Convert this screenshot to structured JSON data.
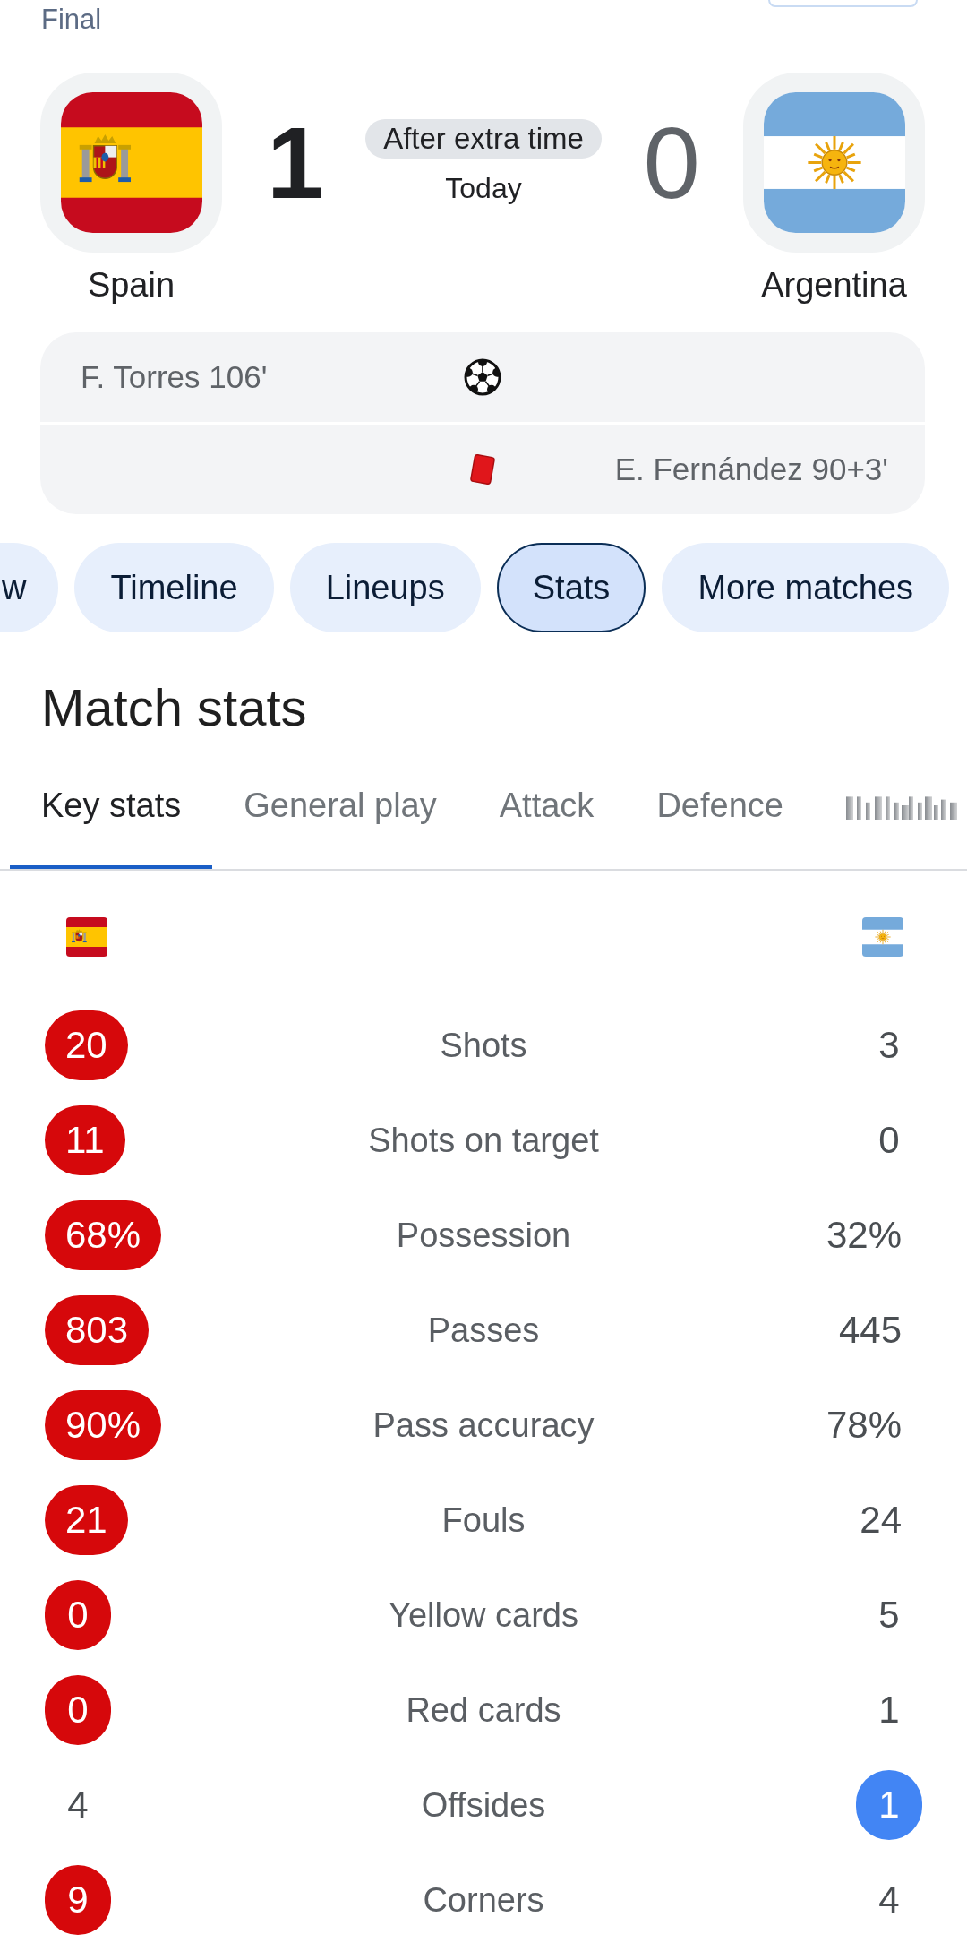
{
  "header": {
    "stage": "Final"
  },
  "teams": [
    {
      "name": "Spain",
      "score": "1",
      "winner": true,
      "kind": "spain"
    },
    {
      "name": "Argentina",
      "score": "0",
      "winner": false,
      "kind": "argentina"
    }
  ],
  "match": {
    "status": "After extra time",
    "date": "Today"
  },
  "events": [
    {
      "away_team": false,
      "kind": "goal",
      "text": "F. Torres 106'"
    },
    {
      "away_team": true,
      "kind": "red_card",
      "text": "E. Fernández 90+3'"
    }
  ],
  "chips": [
    {
      "label": "w",
      "kind": "partial",
      "selected": false
    },
    {
      "label": "Timeline",
      "kind": "full",
      "selected": false
    },
    {
      "label": "Lineups",
      "kind": "full",
      "selected": false
    },
    {
      "label": "Stats",
      "kind": "full",
      "selected": true
    },
    {
      "label": "More matches",
      "kind": "full",
      "selected": false
    }
  ],
  "section_title": "Match stats",
  "tabs": [
    {
      "label": "Key stats",
      "selected": true
    },
    {
      "label": "General play",
      "selected": false
    },
    {
      "label": "Attack",
      "selected": false
    },
    {
      "label": "Defence",
      "selected": false
    }
  ],
  "stats": [
    {
      "label": "Shots",
      "home": {
        "value": "20",
        "highlighted": true
      },
      "away": {
        "value": "3",
        "highlighted": false
      }
    },
    {
      "label": "Shots on target",
      "home": {
        "value": "11",
        "highlighted": true
      },
      "away": {
        "value": "0",
        "highlighted": false
      }
    },
    {
      "label": "Possession",
      "home": {
        "value": "68%",
        "highlighted": true
      },
      "away": {
        "value": "32%",
        "highlighted": false
      }
    },
    {
      "label": "Passes",
      "home": {
        "value": "803",
        "highlighted": true
      },
      "away": {
        "value": "445",
        "highlighted": false
      }
    },
    {
      "label": "Pass accuracy",
      "home": {
        "value": "90%",
        "highlighted": true
      },
      "away": {
        "value": "78%",
        "highlighted": false
      }
    },
    {
      "label": "Fouls",
      "home": {
        "value": "21",
        "highlighted": true
      },
      "away": {
        "value": "24",
        "highlighted": false
      }
    },
    {
      "label": "Yellow cards",
      "home": {
        "value": "0",
        "highlighted": true
      },
      "away": {
        "value": "5",
        "highlighted": false
      }
    },
    {
      "label": "Red cards",
      "home": {
        "value": "0",
        "highlighted": true
      },
      "away": {
        "value": "1",
        "highlighted": false
      }
    },
    {
      "label": "Offsides",
      "home": {
        "value": "4",
        "highlighted": false
      },
      "away": {
        "value": "1",
        "highlighted": true
      }
    },
    {
      "label": "Corners",
      "home": {
        "value": "9",
        "highlighted": true
      },
      "away": {
        "value": "4",
        "highlighted": false
      }
    }
  ]
}
